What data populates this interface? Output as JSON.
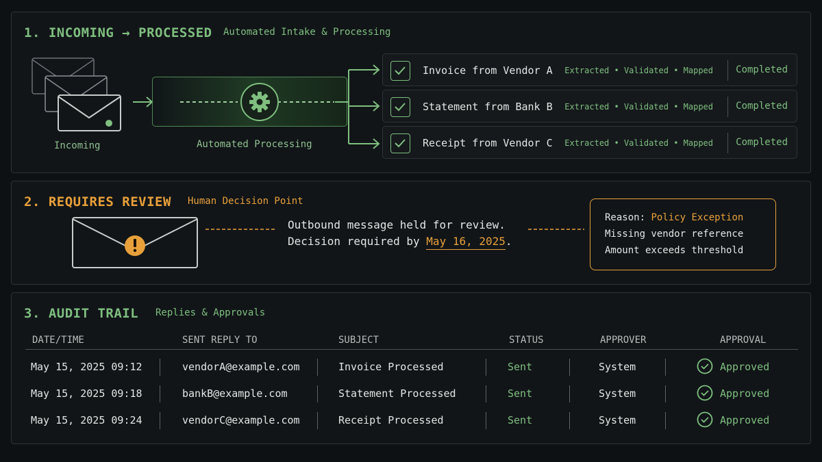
{
  "colors": {
    "accent_green": "#7fbf7f",
    "accent_orange": "#e8a03a",
    "background": "#0e1114"
  },
  "section1": {
    "title": "1. INCOMING → PROCESSED",
    "subtitle": "Automated Intake & Processing",
    "incoming_label": "Incoming",
    "processing_label": "Automated Processing",
    "documents": [
      {
        "name": "Invoice from Vendor A",
        "steps": "Extracted • Validated • Mapped",
        "status": "Completed"
      },
      {
        "name": "Statement from Bank B",
        "steps": "Extracted • Validated • Mapped",
        "status": "Completed"
      },
      {
        "name": "Receipt from Vendor C",
        "steps": "Extracted • Validated • Mapped",
        "status": "Completed"
      }
    ]
  },
  "section2": {
    "title": "2. REQUIRES REVIEW",
    "subtitle": "Human Decision Point",
    "message_line1": "Outbound message held for review.",
    "message_line2_prefix": "Decision required by ",
    "decision_date": "May 16, 2025",
    "message_line2_suffix": ".",
    "reason_label": "Reason: ",
    "reason_value": "Policy Exception",
    "reason_detail1": "Missing vendor reference",
    "reason_detail2": "Amount exceeds threshold"
  },
  "section3": {
    "title": "3. AUDIT TRAIL",
    "subtitle": "Replies & Approvals",
    "columns": [
      "DATE/TIME",
      "SENT REPLY TO",
      "SUBJECT",
      "STATUS",
      "APPROVER",
      "APPROVAL"
    ],
    "rows": [
      {
        "datetime": "May 15, 2025 09:12",
        "reply_to": "vendorA@example.com",
        "subject": "Invoice Processed",
        "status": "Sent",
        "approver": "System",
        "approval": "Approved"
      },
      {
        "datetime": "May 15, 2025 09:18",
        "reply_to": "bankB@example.com",
        "subject": "Statement Processed",
        "status": "Sent",
        "approver": "System",
        "approval": "Approved"
      },
      {
        "datetime": "May 15, 2025 09:24",
        "reply_to": "vendorC@example.com",
        "subject": "Receipt Processed",
        "status": "Sent",
        "approver": "System",
        "approval": "Approved"
      }
    ]
  }
}
